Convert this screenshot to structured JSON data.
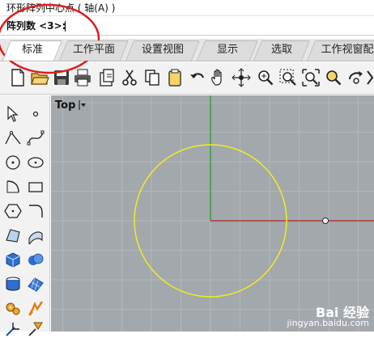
{
  "command": {
    "history_text": "环形阵列中心点 ( 轴(A) )",
    "prompt_text": "阵列数 <3>:"
  },
  "tabs": [
    {
      "label": "标准",
      "active": true
    },
    {
      "label": "工作平面",
      "active": false
    },
    {
      "label": "设置视图",
      "active": false
    },
    {
      "label": "显示",
      "active": false
    },
    {
      "label": "选取",
      "active": false
    },
    {
      "label": "工作视窗配",
      "active": false
    }
  ],
  "toolbar_icons": [
    "new-file-icon",
    "open-folder-icon",
    "save-icon",
    "print-icon",
    "import-icon",
    "cut-icon",
    "copy-icon",
    "paste-icon",
    "undo-icon",
    "pan-hand-icon",
    "rotate-view-icon",
    "zoom-icon",
    "zoom-window-icon",
    "zoom-extents-icon",
    "zoom-selected-icon",
    "rotate-camera-icon",
    "more-icon"
  ],
  "viewport": {
    "title": "Top",
    "background": "#a3a8ad",
    "grid_color": "#b2b7bb",
    "x_axis_color": "#b03a2e",
    "y_axis_color": "#3fa243",
    "circle_color": "#f2ee1c"
  },
  "watermark": {
    "line1": "Bai 经验",
    "line2": "jingyan.baidu.com"
  },
  "accent": {
    "annotation_red": "#e01e1e"
  }
}
